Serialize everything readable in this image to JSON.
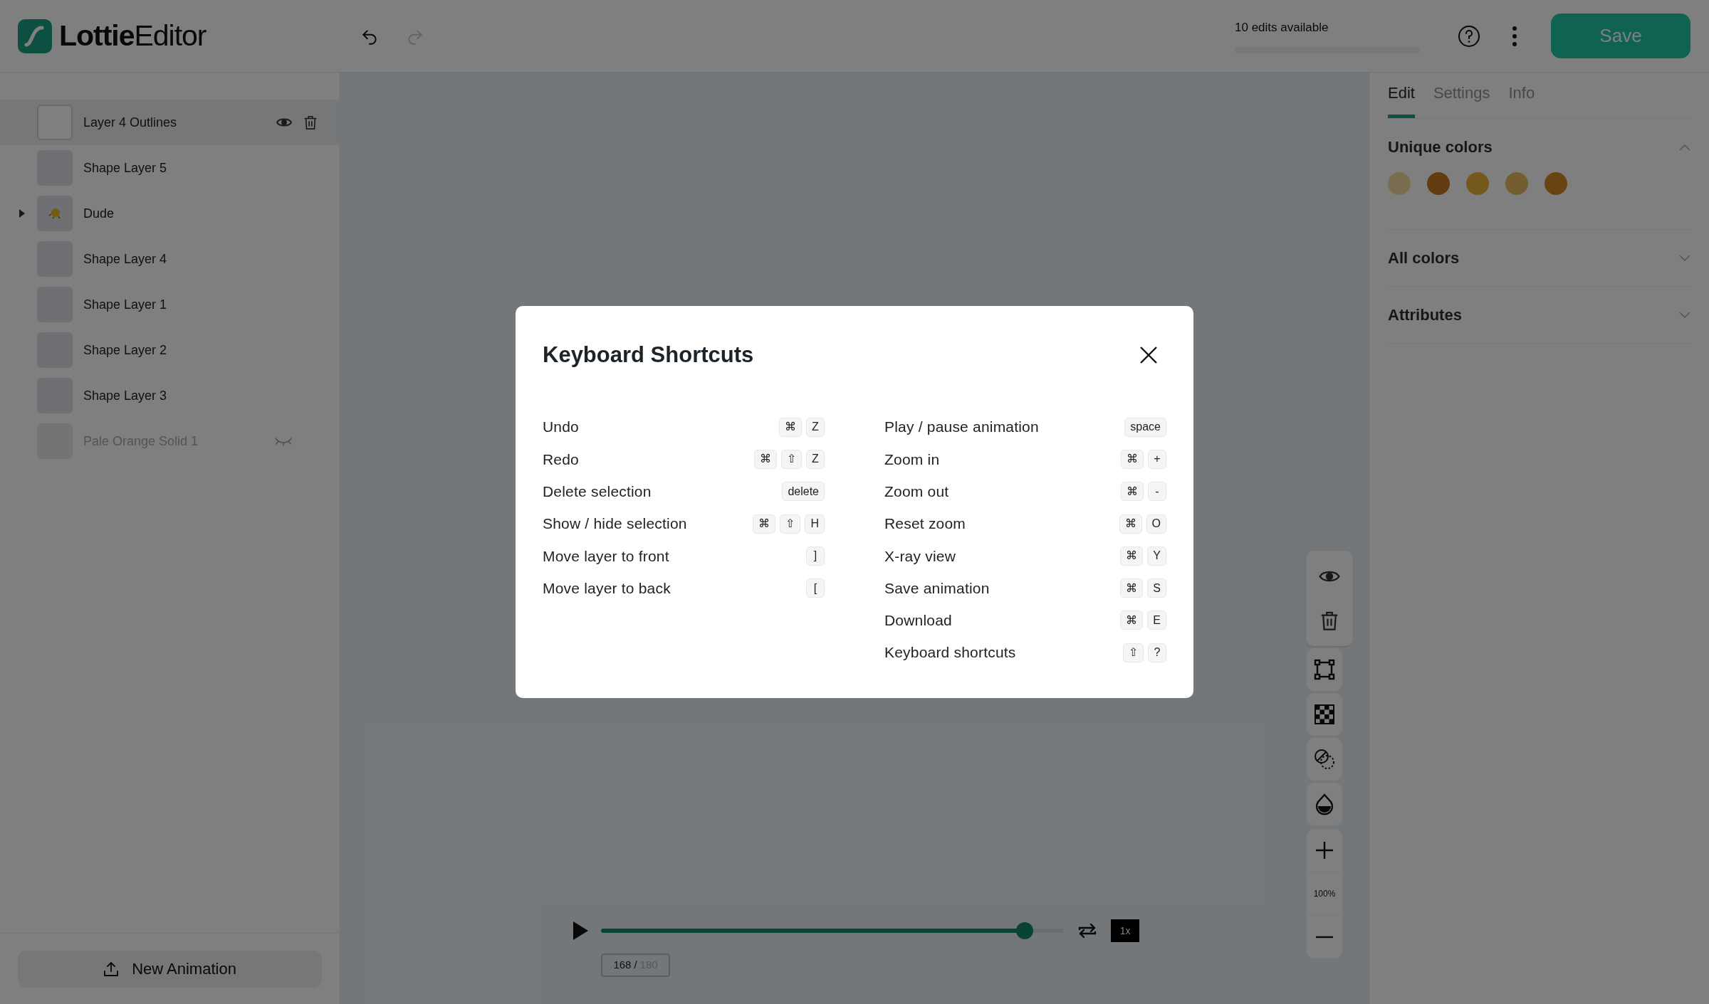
{
  "header": {
    "logo": "**Lottie**Editor",
    "undo": {
      "disabled": false
    },
    "redo": {
      "disabled": true
    },
    "edits": {
      "label": "10 edits available",
      "level": 0
    },
    "save": "Save"
  },
  "layers": [
    {
      "name": "Layer 4 Outlines",
      "kind": "shape",
      "selected": true,
      "hidden": false
    },
    {
      "name": "Shape Layer 5",
      "kind": "shape",
      "selected": false,
      "hidden": false
    },
    {
      "name": "Dude",
      "kind": "group",
      "selected": false,
      "hidden": false
    },
    {
      "name": "Shape Layer 4",
      "kind": "shape",
      "selected": false,
      "hidden": false
    },
    {
      "name": "Shape Layer 1",
      "kind": "shape",
      "selected": false,
      "hidden": false
    },
    {
      "name": "Shape Layer 2",
      "kind": "shape",
      "selected": false,
      "hidden": false
    },
    {
      "name": "Shape Layer 3",
      "kind": "shape",
      "selected": false,
      "hidden": false
    },
    {
      "name": "Pale Orange Solid 1",
      "kind": "shape",
      "selected": false,
      "hidden": true
    }
  ],
  "new_animation": "New Animation",
  "tabs": [
    {
      "label": "Edit",
      "selected": true
    },
    {
      "label": "Settings",
      "selected": false
    },
    {
      "label": "Info",
      "selected": false
    }
  ],
  "sections": [
    {
      "title": "Unique colors",
      "expanded": true,
      "colors": [
        {
          "color": "#7a6c4f"
        },
        {
          "color": "#643c12"
        },
        {
          "color": "#74581c"
        },
        {
          "color": "#735e30"
        },
        {
          "color": "#674411"
        }
      ]
    },
    {
      "title": "All colors",
      "expanded": false
    },
    {
      "title": "Attributes",
      "expanded": false
    }
  ],
  "toolbar": {
    "zoom": "100%"
  },
  "player": {
    "playing": false,
    "level": 0.915,
    "frame": "168",
    "separator": "/",
    "total": "180",
    "speed": "1x"
  },
  "modal": {
    "title": "Keyboard Shortcuts",
    "columns": [
      [
        {
          "label": "Undo",
          "keys": [
            "⌘",
            "Z"
          ]
        },
        {
          "label": "Redo",
          "keys": [
            "⌘",
            "⇧",
            "Z"
          ]
        },
        {
          "label": "Delete selection",
          "keys": [
            "delete"
          ]
        },
        {
          "label": "Show / hide selection",
          "keys": [
            "⌘",
            "⇧",
            "H"
          ]
        },
        {
          "label": "Move layer to front",
          "keys": [
            "]"
          ]
        },
        {
          "label": "Move layer to back",
          "keys": [
            "["
          ]
        }
      ],
      [
        {
          "label": "Play / pause animation",
          "keys": [
            "space"
          ]
        },
        {
          "label": "Zoom in",
          "keys": [
            "⌘",
            "+"
          ]
        },
        {
          "label": "Zoom out",
          "keys": [
            "⌘",
            "-"
          ]
        },
        {
          "label": "Reset zoom",
          "keys": [
            "⌘",
            "O"
          ]
        },
        {
          "label": "X-ray view",
          "keys": [
            "⌘",
            "Y"
          ]
        },
        {
          "label": "Save animation",
          "keys": [
            "⌘",
            "S"
          ]
        },
        {
          "label": "Download",
          "keys": [
            "⌘",
            "E"
          ]
        },
        {
          "label": "Keyboard shortcuts",
          "keys": [
            "⇧",
            "?"
          ]
        }
      ]
    ]
  }
}
